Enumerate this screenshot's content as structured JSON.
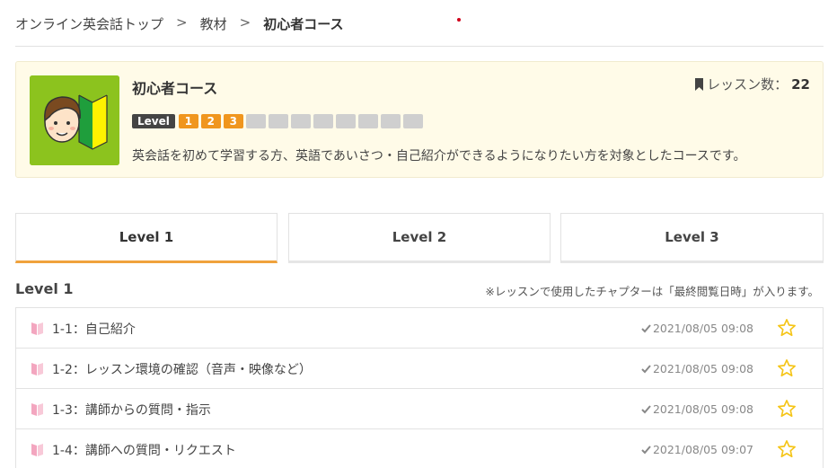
{
  "breadcrumb": {
    "items": [
      "オンライン英会話トップ",
      "教材"
    ],
    "separator": ">",
    "current": "初心者コース"
  },
  "course": {
    "title": "初心者コース",
    "lesson_count_label": "レッスン数：",
    "lesson_count": "22",
    "level_tag": "Level",
    "levels": [
      "1",
      "2",
      "3",
      "",
      "",
      "",
      "",
      "",
      "",
      "",
      ""
    ],
    "description": "英会話を初めて学習する方、英語であいさつ・自己紹介ができるようになりたい方を対象としたコースです。",
    "thumb_color": "#8cc31e"
  },
  "tabs": [
    {
      "label": "Level 1",
      "active": true
    },
    {
      "label": "Level 2",
      "active": false
    },
    {
      "label": "Level 3",
      "active": false
    }
  ],
  "section": {
    "title": "Level 1",
    "note": "※レッスンで使用したチャプターは「最終閲覧日時」が入ります。"
  },
  "lessons": [
    {
      "title": "1-1：自己紹介",
      "date": "2021/08/05 09:08"
    },
    {
      "title": "1-2：レッスン環境の確認（音声・映像など）",
      "date": "2021/08/05 09:08"
    },
    {
      "title": "1-3：講師からの質問・指示",
      "date": "2021/08/05 09:08"
    },
    {
      "title": "1-4：講師への質問・リクエスト",
      "date": "2021/08/05 09:07"
    }
  ],
  "colors": {
    "accent": "#f0a23c",
    "level_on": "#f0961e",
    "level_off": "#cfcfcf",
    "card_bg": "#fffbe8",
    "star": "#f5c518",
    "book": "#f3a6bf"
  },
  "icons": {
    "bookmark": "bookmark-icon",
    "book": "book-icon",
    "check": "check-icon",
    "star": "star-outline-icon"
  }
}
